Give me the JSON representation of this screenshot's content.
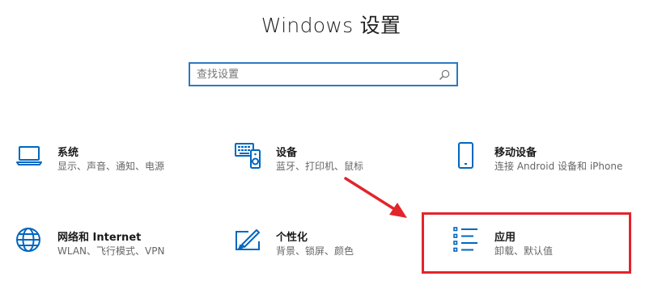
{
  "window": {
    "title": "Windows 设置"
  },
  "search": {
    "placeholder": "查找设置",
    "value": ""
  },
  "tiles": [
    {
      "name": "系统",
      "desc": "显示、声音、通知、电源",
      "icon": "laptop-icon"
    },
    {
      "name": "设备",
      "desc": "蓝牙、打印机、鼠标",
      "icon": "devices-icon"
    },
    {
      "name": "移动设备",
      "desc": "连接 Android 设备和 iPhone",
      "icon": "phone-icon"
    },
    {
      "name": "网络和 Internet",
      "desc": "WLAN、飞行模式、VPN",
      "icon": "globe-icon"
    },
    {
      "name": "个性化",
      "desc": "背景、锁屏、颜色",
      "icon": "personalization-icon"
    },
    {
      "name": "应用",
      "desc": "卸载、默认值",
      "icon": "apps-list-icon"
    }
  ],
  "colors": {
    "accent": "#0067c0",
    "search_border": "#2b79c2",
    "annotation": "#e3242b"
  }
}
